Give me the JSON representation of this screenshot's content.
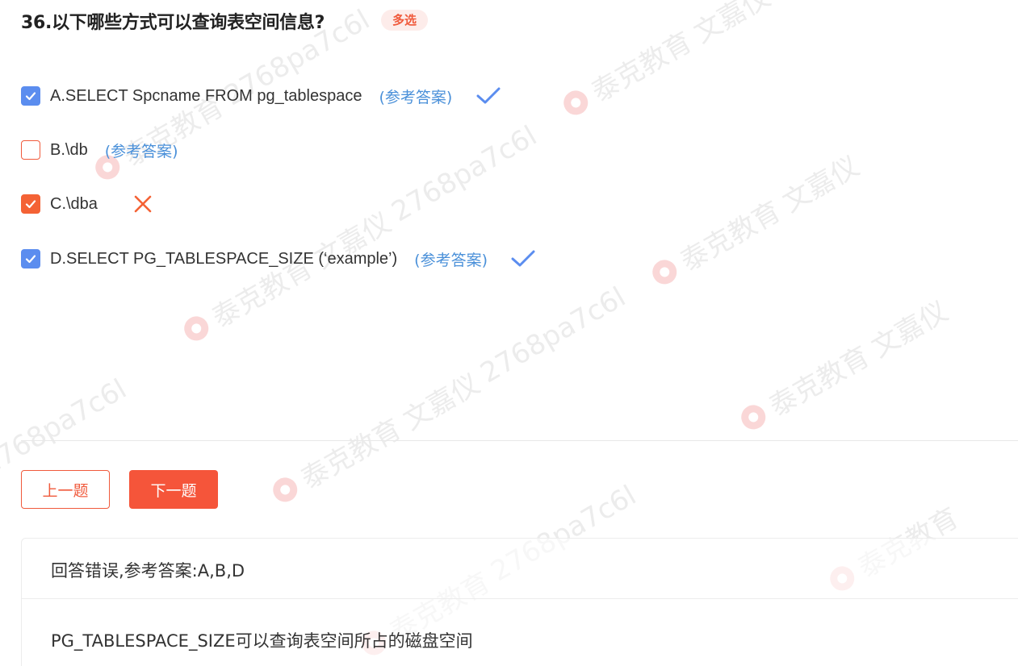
{
  "question": {
    "title": "36.以下哪些方式可以查询表空间信息?",
    "tag": "多选"
  },
  "options": [
    {
      "text": "A.SELECT Spcname FROM pg_tablespace",
      "checked": true,
      "reference": "(参考答案)",
      "result": "correct"
    },
    {
      "text": "B.\\db",
      "checked": false,
      "reference": "(参考答案)",
      "result": ""
    },
    {
      "text": "C.\\dba",
      "checked": true,
      "reference": "",
      "result": "wrong"
    },
    {
      "text": "D.SELECT PG_TABLESPACE_SIZE (‘example’)",
      "checked": true,
      "reference": "(参考答案)",
      "result": "correct"
    }
  ],
  "navigation": {
    "prev_label": "上一题",
    "next_label": "下一题"
  },
  "answer": {
    "result_text": "回答错误,参考答案:A,B,D",
    "explanation": "PG_TABLESPACE_SIZE可以查询表空间所占的磁盘空间"
  },
  "watermark": {
    "brand": "泰克教育",
    "code": "2768pa7c6l",
    "name": "文嘉仪"
  },
  "colors": {
    "accent": "#f5553a",
    "checkbox_blue": "#5b8def",
    "checkbox_orange": "#f46235",
    "reference_blue": "#4a90d9",
    "tag_bg": "#fdecea"
  }
}
